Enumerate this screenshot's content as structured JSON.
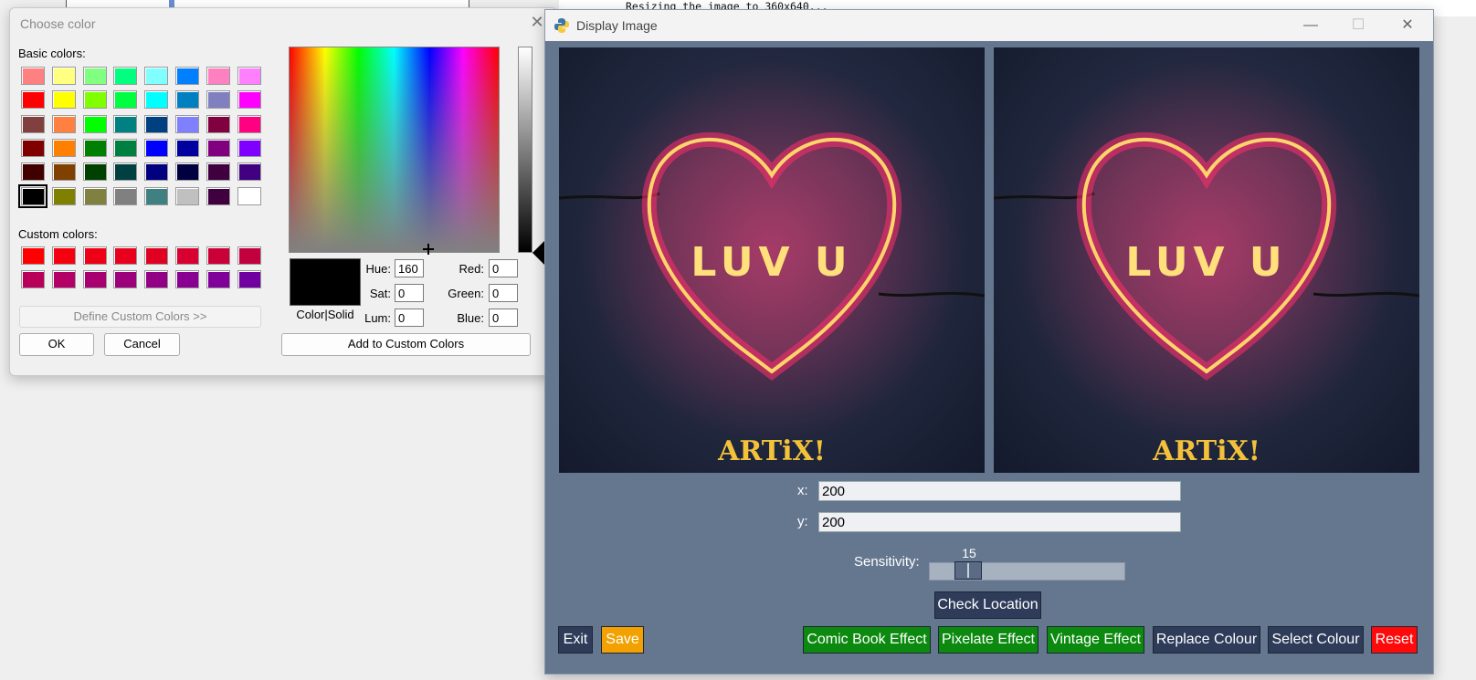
{
  "terminal": {
    "line": "Resizing the image to 360x640..."
  },
  "color_dialog": {
    "title": "Choose color",
    "basic_colors_label": "Basic colors:",
    "custom_colors_label": "Custom colors:",
    "basic_colors": [
      [
        "#ff8080",
        "#ffff80",
        "#80ff80",
        "#00ff80",
        "#80ffff",
        "#0080ff",
        "#ff80c0",
        "#ff80ff"
      ],
      [
        "#ff0000",
        "#ffff00",
        "#80ff00",
        "#00ff40",
        "#00ffff",
        "#0080c0",
        "#8080c0",
        "#ff00ff"
      ],
      [
        "#804040",
        "#ff8040",
        "#00ff00",
        "#008080",
        "#004080",
        "#8080ff",
        "#800040",
        "#ff0080"
      ],
      [
        "#800000",
        "#ff8000",
        "#008000",
        "#008040",
        "#0000ff",
        "#0000a0",
        "#800080",
        "#8000ff"
      ],
      [
        "#400000",
        "#804000",
        "#004000",
        "#004040",
        "#000080",
        "#000040",
        "#400040",
        "#400080"
      ],
      [
        "#000000",
        "#808000",
        "#808040",
        "#808080",
        "#408080",
        "#c0c0c0",
        "#400040",
        "#ffffff"
      ]
    ],
    "custom_colors": [
      [
        "#ff0000",
        "#f5000f",
        "#ee0016",
        "#e8001c",
        "#e00022",
        "#d80030",
        "#cc0038",
        "#c2003e"
      ],
      [
        "#b8005a",
        "#b40066",
        "#a80070",
        "#9c007a",
        "#920086",
        "#8a0090",
        "#80009a",
        "#7000a0"
      ]
    ],
    "define_custom_label": "Define Custom Colors >>",
    "ok_label": "OK",
    "cancel_label": "Cancel",
    "add_custom_label": "Add to Custom Colors",
    "color_solid_label": "Color|Solid",
    "fields": {
      "hue_label": "Hue:",
      "hue": "160",
      "sat_label": "Sat:",
      "sat": "0",
      "lum_label": "Lum:",
      "lum": "0",
      "red_label": "Red:",
      "red": "0",
      "green_label": "Green:",
      "green": "0",
      "blue_label": "Blue:",
      "blue": "0"
    }
  },
  "display_window": {
    "title": "Display Image",
    "minimize": "—",
    "maximize": "☐",
    "close": "✕",
    "image_text": "LUV U",
    "image_brand": "ARTiX!",
    "x_label": "x:",
    "x_value": "200",
    "y_label": "y:",
    "y_value": "200",
    "sensitivity_label": "Sensitivity:",
    "sensitivity_value": "15",
    "sensitivity_fraction": 0.15,
    "check_location": "Check Location",
    "buttons": {
      "exit": "Exit",
      "save": "Save",
      "comic": "Comic Book Effect",
      "pixelate": "Pixelate Effect",
      "vintage": "Vintage Effect",
      "replace": "Replace Colour",
      "select": "Select Colour",
      "reset": "Reset"
    }
  }
}
